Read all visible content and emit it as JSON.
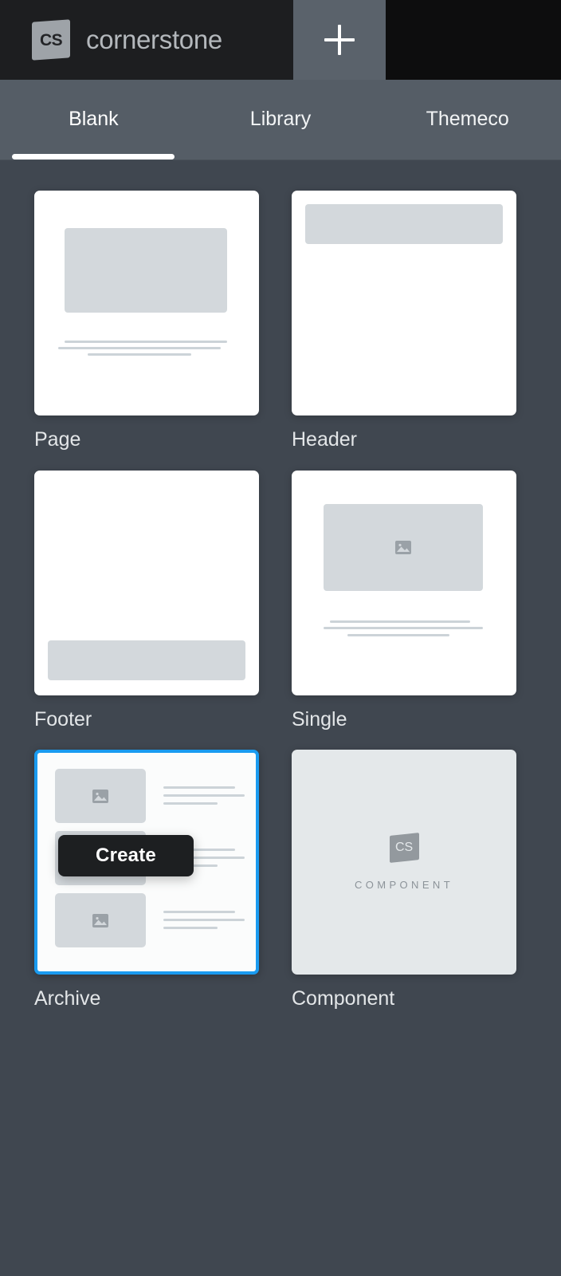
{
  "topbar": {
    "brand_abbr": "CS",
    "brand_name": "cornerstone",
    "add_icon": "plus-icon"
  },
  "tabs": [
    {
      "label": "Blank",
      "active": true
    },
    {
      "label": "Library",
      "active": false
    },
    {
      "label": "Themeco",
      "active": false
    }
  ],
  "grid": {
    "items": [
      {
        "label": "Page",
        "type": "page",
        "selected": false
      },
      {
        "label": "Header",
        "type": "header",
        "selected": false
      },
      {
        "label": "Footer",
        "type": "footer",
        "selected": false
      },
      {
        "label": "Single",
        "type": "single",
        "selected": false
      },
      {
        "label": "Archive",
        "type": "archive",
        "selected": true
      },
      {
        "label": "Component",
        "type": "component",
        "selected": false
      }
    ]
  },
  "overlay": {
    "create_label": "Create"
  },
  "component_card": {
    "mark_abbr": "CS",
    "caption": "COMPONENT"
  },
  "colors": {
    "background": "#404750",
    "tabbar": "#555d66",
    "brand_tab": "#1d1e20",
    "plus_tab": "#5a626b",
    "topbar_rest": "#0d0d0e",
    "selection_blue": "#1a9bf0",
    "create_button": "#1d1f21",
    "skeleton_block": "#d3d8dc",
    "component_bg": "#e4e8ea"
  }
}
